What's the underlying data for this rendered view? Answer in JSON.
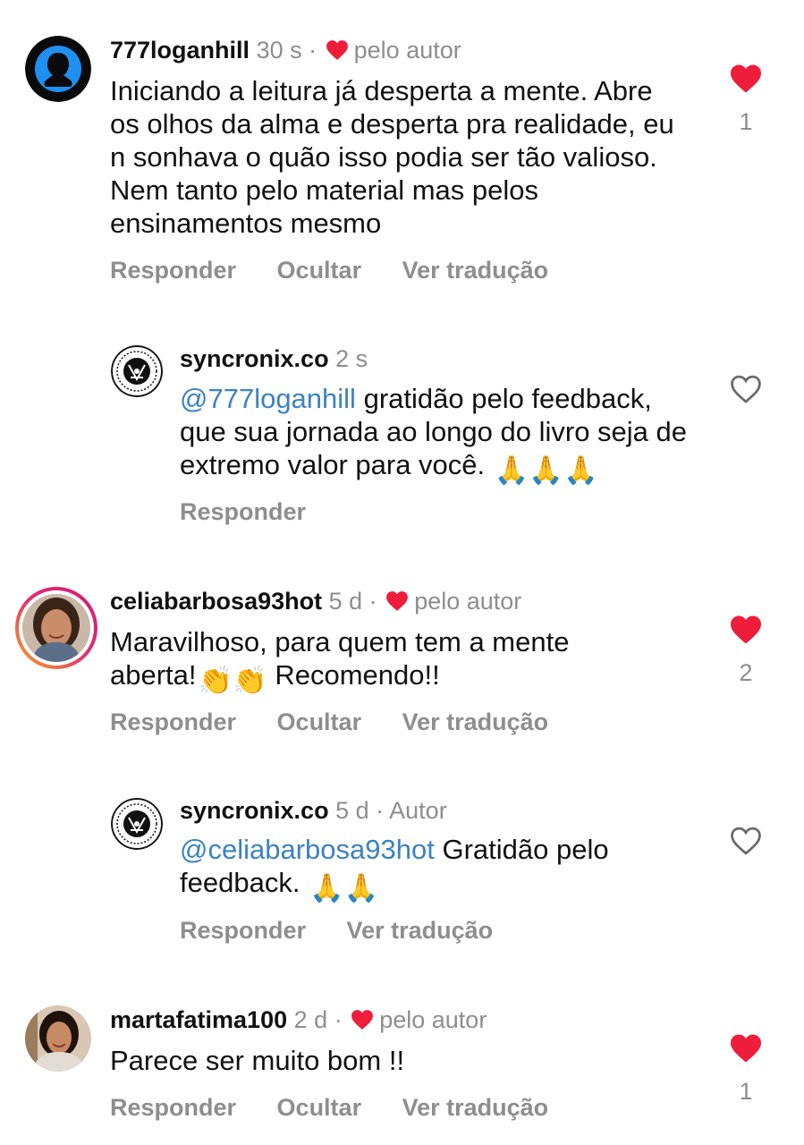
{
  "comments": [
    {
      "username": "777loganhill",
      "time": "30 s",
      "dot": "·",
      "by_author": "pelo autor",
      "text": "Iniciando a leitura já desperta a mente. Abre os olhos da alma e desperta pra realidade, eu n sonhava o quão isso podia ser tão valioso. Nem tanto pelo material mas pelos ensinamentos mesmo",
      "actions": [
        "Responder",
        "Ocultar",
        "Ver tradução"
      ],
      "liked": true,
      "likes": "1"
    },
    {
      "username": "syncronix.co",
      "time": "2 s",
      "mention": "@777loganhill",
      "text": "gratidão pelo feedback, que sua jornada ao longo do livro seja de extremo valor para você.",
      "emoji": "🙏🙏🙏",
      "actions": [
        "Responder"
      ],
      "liked": false
    },
    {
      "username": "celiabarbosa93hot",
      "time": "5 d",
      "dot": "·",
      "by_author": "pelo autor",
      "text_before": "Maravilhoso, para quem tem a mente aberta!",
      "emoji": "👏👏",
      "text_after": "Recomendo!!",
      "actions": [
        "Responder",
        "Ocultar",
        "Ver tradução"
      ],
      "liked": true,
      "likes": "2"
    },
    {
      "username": "syncronix.co",
      "time": "5 d",
      "dot": "·",
      "author_label": "Autor",
      "mention": "@celiabarbosa93hot",
      "text": "Gratidão pelo feedback.",
      "emoji": "🙏🙏",
      "actions": [
        "Responder",
        "Ver tradução"
      ],
      "liked": false
    },
    {
      "username": "martafatima100",
      "time": "2 d",
      "dot": "·",
      "by_author": "pelo autor",
      "text": "Parece ser muito bom !!",
      "actions": [
        "Responder",
        "Ocultar",
        "Ver tradução"
      ],
      "liked": true,
      "likes": "1"
    }
  ],
  "icons": {
    "heart_filled": "heart-filled-icon",
    "heart_outline": "heart-outline-icon"
  },
  "colors": {
    "heart": "#ee1d3a",
    "mention": "#3b82c4",
    "muted": "#8e8e8e",
    "story_ring_start": "#f9a826",
    "story_ring_end": "#d3197a"
  }
}
